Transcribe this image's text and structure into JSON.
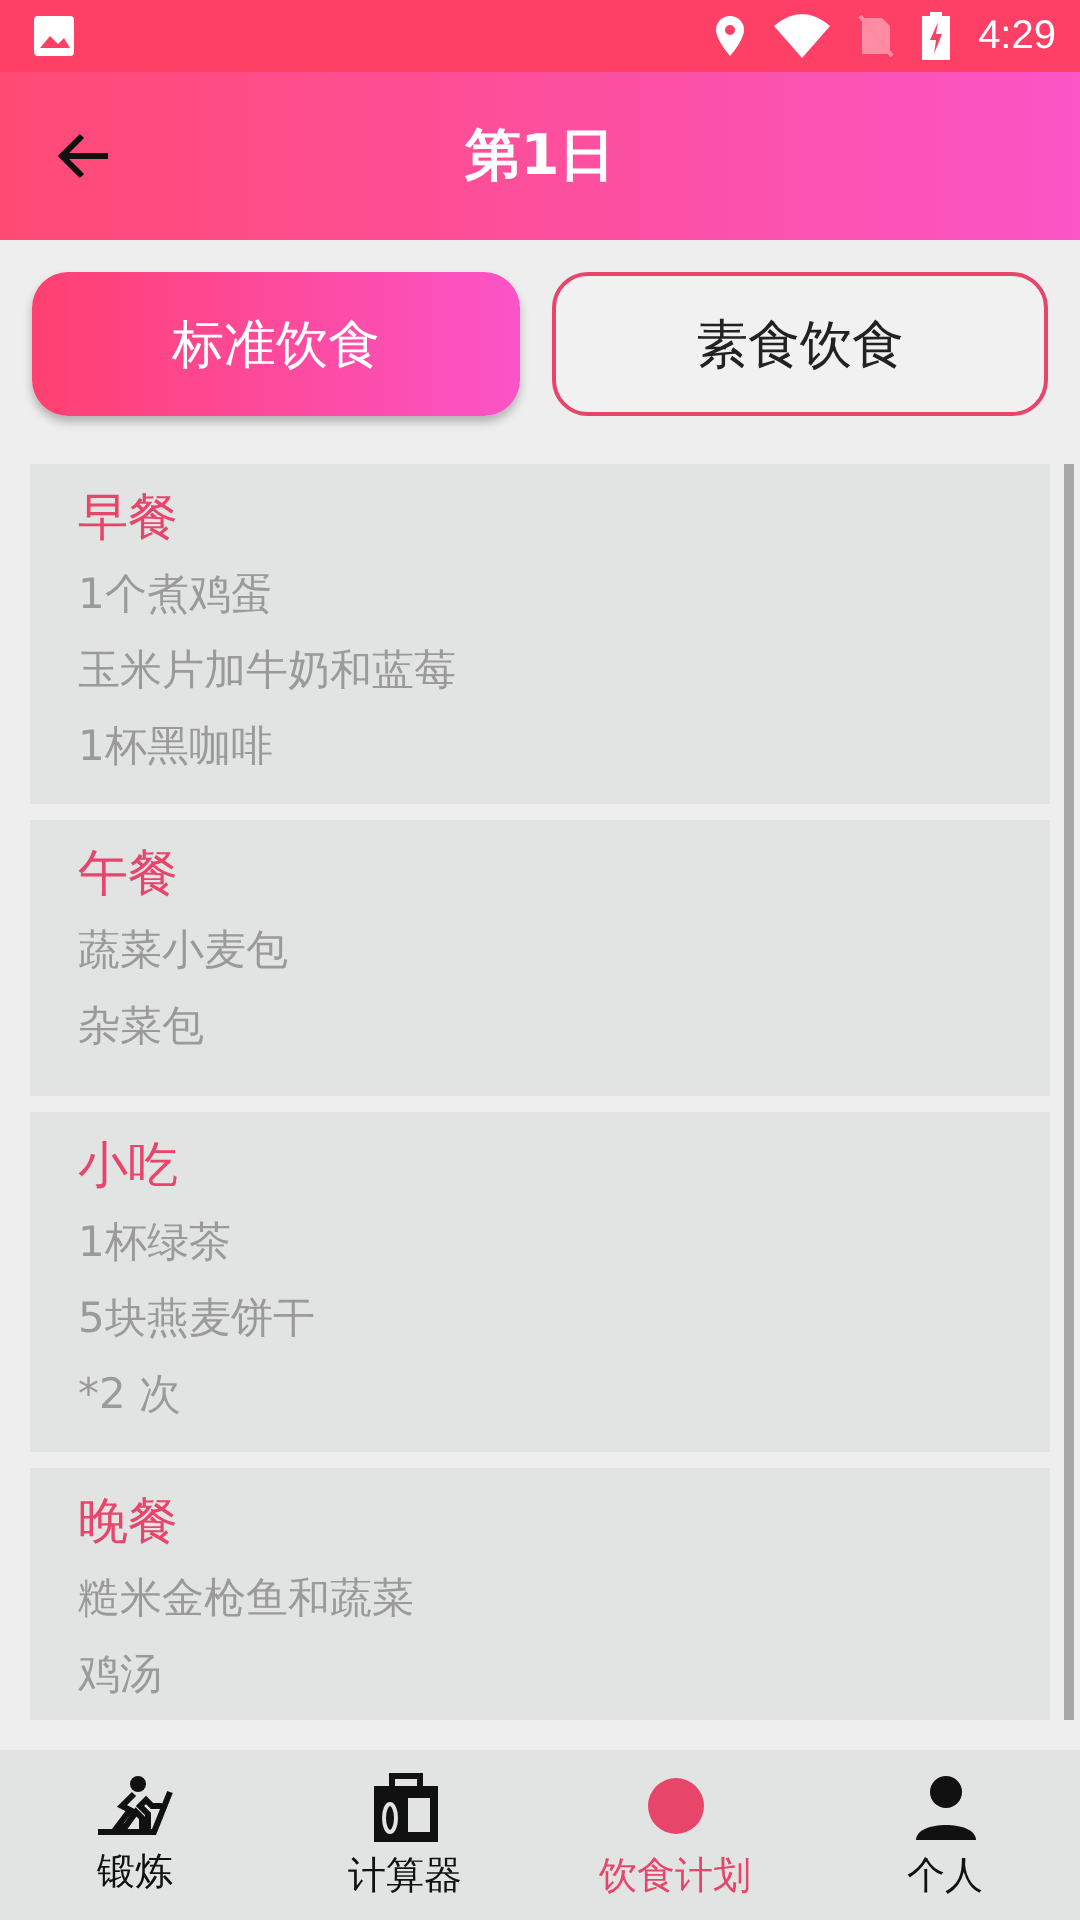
{
  "status_bar": {
    "time": "4:29"
  },
  "app_bar": {
    "title": "第1日"
  },
  "tabs": [
    {
      "label": "标准饮食",
      "selected": true
    },
    {
      "label": "素食饮食",
      "selected": false
    }
  ],
  "meals": [
    {
      "title": "早餐",
      "items": [
        "1个煮鸡蛋",
        "玉米片加牛奶和蓝莓",
        "1杯黑咖啡"
      ]
    },
    {
      "title": "午餐",
      "items": [
        "蔬菜小麦包",
        "杂菜包"
      ]
    },
    {
      "title": "小吃",
      "items": [
        "1杯绿茶",
        "5块燕麦饼干",
        "*2 次"
      ]
    },
    {
      "title": "晚餐",
      "items": [
        "糙米金枪鱼和蔬菜",
        "鸡汤"
      ]
    }
  ],
  "bottom_nav": [
    {
      "label": "锻炼",
      "kind": "run",
      "selected": false
    },
    {
      "label": "计算器",
      "kind": "calc",
      "selected": false
    },
    {
      "label": "饮食计划",
      "kind": "plan",
      "selected": true
    },
    {
      "label": "个人",
      "kind": "person",
      "selected": false
    }
  ]
}
